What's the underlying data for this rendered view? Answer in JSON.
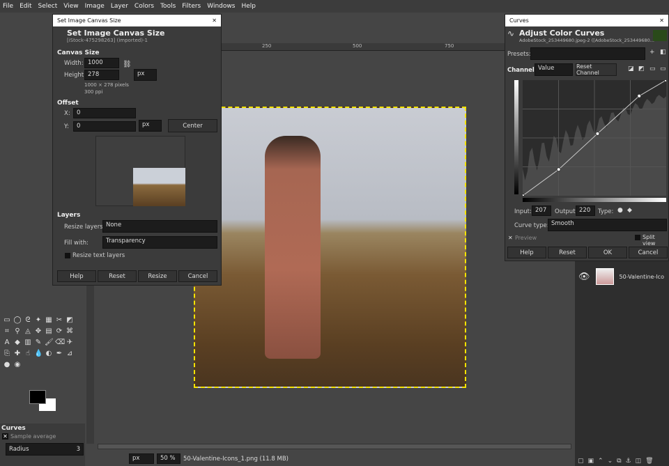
{
  "menu": [
    "File",
    "Edit",
    "Select",
    "View",
    "Image",
    "Layer",
    "Colors",
    "Tools",
    "Filters",
    "Windows",
    "Help"
  ],
  "ruler": {
    "ticks": [
      "250",
      "500",
      "750"
    ]
  },
  "canvas_dialog": {
    "window_title": "Set Image Canvas Size",
    "heading": "Set Image Canvas Size",
    "subheading": "[iStock-475298263] (imported)-1",
    "canvas_size_label": "Canvas Size",
    "width_label": "Width:",
    "width_value": "1000",
    "height_label": "Height:",
    "height_value": "278",
    "unit": "px",
    "pixels_info": "1000 × 278 pixels",
    "ppi_info": "300 ppi",
    "offset_label": "Offset",
    "x_label": "X:",
    "x_value": "0",
    "y_label": "Y:",
    "y_value": "0",
    "offset_unit": "px",
    "center_button": "Center",
    "layers_label": "Layers",
    "resize_layers_label": "Resize layers:",
    "resize_layers_value": "None",
    "fill_with_label": "Fill with:",
    "fill_with_value": "Transparency",
    "resize_text_layers": "Resize text layers",
    "buttons": [
      "Help",
      "Reset",
      "Resize",
      "Cancel"
    ]
  },
  "curves_dialog": {
    "window_title": "Curves",
    "heading": "Adjust Color Curves",
    "subheading": "AdobeStock_253449680.jpeg-2 ([AdobeStock_253449680...",
    "presets_label": "Presets:",
    "channel_label": "Channel:",
    "channel_value": "Value",
    "reset_channel": "Reset Channel",
    "curve_points": [
      [
        0,
        0
      ],
      [
        64,
        58
      ],
      [
        133,
        137
      ],
      [
        207,
        220
      ],
      [
        255,
        255
      ]
    ],
    "input_label": "Input:",
    "input_value": "207",
    "output_label": "Output:",
    "output_value": "220",
    "type_label": "Type:",
    "curve_type_label": "Curve type:",
    "curve_type_value": "Smooth",
    "preview": "Preview",
    "split_view": "Split view",
    "buttons": [
      "Help",
      "Reset",
      "OK",
      "Cancel"
    ]
  },
  "tool_options": {
    "title": "Curves",
    "sample_average": "Sample average",
    "radius_label": "Radius",
    "radius_value": "3"
  },
  "layers": {
    "layer_name": "50-Valentine-Ico"
  },
  "status": {
    "unit": "px",
    "zoom": "50 %",
    "file": "50-Valentine-Icons_1.png (11.8 MB)"
  },
  "colors": {
    "accent_selection": "#f5e400",
    "bg": "#454545",
    "panel": "#3b3b3b"
  }
}
